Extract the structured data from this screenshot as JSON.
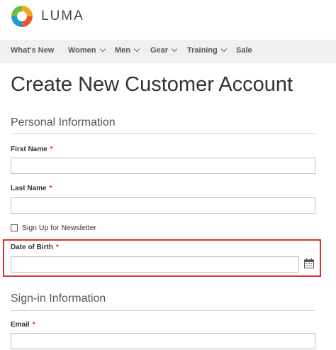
{
  "brand": {
    "name": "LUMA"
  },
  "nav": {
    "items": [
      {
        "label": "What's New",
        "dropdown": false
      },
      {
        "label": "Women",
        "dropdown": true
      },
      {
        "label": "Men",
        "dropdown": true
      },
      {
        "label": "Gear",
        "dropdown": true
      },
      {
        "label": "Training",
        "dropdown": true
      },
      {
        "label": "Sale",
        "dropdown": false
      }
    ]
  },
  "page": {
    "title": "Create New Customer Account"
  },
  "personal": {
    "title": "Personal Information",
    "first_name": {
      "label": "First Name",
      "required": "*",
      "value": ""
    },
    "last_name": {
      "label": "Last Name",
      "required": "*",
      "value": ""
    },
    "newsletter": {
      "label": "Sign Up for Newsletter",
      "checked": false
    },
    "dob": {
      "label": "Date of Birth",
      "required": "*",
      "value": ""
    }
  },
  "signin": {
    "title": "Sign-in Information",
    "email": {
      "label": "Email",
      "required": "*",
      "value": ""
    }
  },
  "colors": {
    "required": "#e02b27",
    "highlight": "#d9332b",
    "nav_bg": "#f0f0f0"
  },
  "icons": {
    "calendar": "calendar-icon",
    "logo": "luma-logo-icon"
  }
}
